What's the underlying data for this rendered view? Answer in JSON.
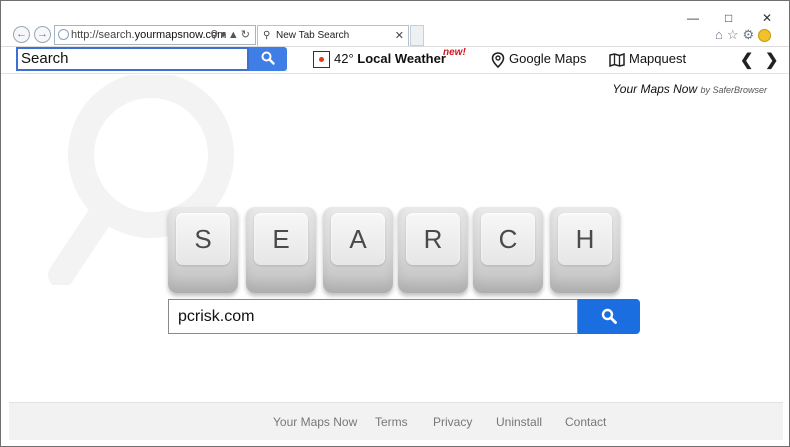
{
  "browser": {
    "address": {
      "prefix": "http://search.",
      "host": "yourmapsnow.com"
    },
    "tab": {
      "title": "New Tab Search"
    }
  },
  "toolbar": {
    "search_value": "Search",
    "weather": {
      "temp": "42°",
      "label": "Local Weather",
      "badge": "new!"
    },
    "links": [
      {
        "label": "Google Maps"
      },
      {
        "label": "Mapquest"
      }
    ]
  },
  "brand": {
    "name": "Your Maps Now",
    "by": "by SaferBrowser"
  },
  "keys": [
    "S",
    "E",
    "A",
    "R",
    "C",
    "H"
  ],
  "main_search": {
    "value": "pcrisk.com"
  },
  "footer": {
    "links": [
      "Your Maps Now",
      "Terms",
      "Privacy",
      "Uninstall",
      "Contact"
    ]
  },
  "colors": {
    "search_button": "#1a6ee0",
    "toolbar_search_border": "#3f6fd3",
    "new_badge": "#d1181e"
  },
  "icons": [
    "back-icon",
    "forward-icon",
    "search-icon",
    "refresh-icon",
    "close-icon",
    "minimize-icon",
    "maximize-icon",
    "home-icon",
    "star-icon",
    "gear-icon",
    "smiley-icon",
    "weather-icon",
    "map-pin-icon",
    "map-icon",
    "chevron-left-icon",
    "chevron-right-icon"
  ]
}
